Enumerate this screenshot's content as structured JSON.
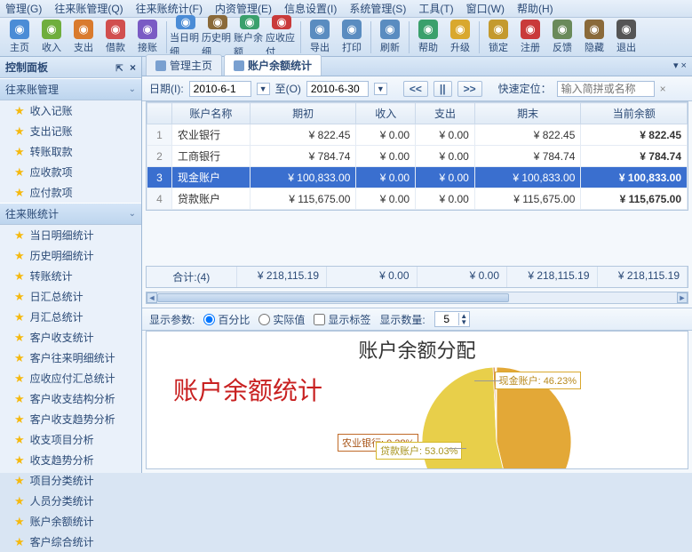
{
  "menu": [
    "管理(G)",
    "往来账管理(Q)",
    "往来账统计(F)",
    "内资管理(E)",
    "信息设置(I)",
    "系统管理(S)",
    "工具(T)",
    "窗口(W)",
    "帮助(H)"
  ],
  "toolbar": [
    {
      "label": "主页",
      "color": "#4b8cd6"
    },
    {
      "label": "收入",
      "color": "#6fae3d"
    },
    {
      "label": "支出",
      "color": "#d97b2e"
    },
    {
      "label": "借款",
      "color": "#d14f4f"
    },
    {
      "label": "接账",
      "color": "#7a5bc4"
    },
    {
      "sep": true
    },
    {
      "label": "当日明细",
      "color": "#4b8cd6"
    },
    {
      "label": "历史明细",
      "color": "#8a6a3a"
    },
    {
      "label": "账户余额",
      "color": "#3aa06c"
    },
    {
      "label": "应收应付",
      "color": "#c93a3a"
    },
    {
      "sep": true
    },
    {
      "label": "导出",
      "color": "#5a8cc0"
    },
    {
      "label": "打印",
      "color": "#5a8cc0"
    },
    {
      "sep": true
    },
    {
      "label": "刷新",
      "color": "#5a8cc0"
    },
    {
      "sep": true
    },
    {
      "label": "帮助",
      "color": "#3aa06c"
    },
    {
      "label": "升级",
      "color": "#d9a82e"
    },
    {
      "sep": true
    },
    {
      "label": "锁定",
      "color": "#c49a2e"
    },
    {
      "label": "注册",
      "color": "#c93a3a"
    },
    {
      "label": "反馈",
      "color": "#6a8a5a"
    },
    {
      "label": "隐藏",
      "color": "#8a6a3a"
    },
    {
      "label": "退出",
      "color": "#555"
    }
  ],
  "panel_title": "控制面板",
  "pin_symbol": "⇱",
  "close_symbol": "×",
  "sidebar": [
    {
      "header": "往来账管理",
      "items": [
        "收入记账",
        "支出记账",
        "转账取款",
        "应收款项",
        "应付款项"
      ]
    },
    {
      "header": "往来账统计",
      "items": [
        "当日明细统计",
        "历史明细统计",
        "转账统计",
        "日汇总统计",
        "月汇总统计",
        "客户收支统计",
        "客户往来明细统计",
        "应收应付汇总统计",
        "客户收支结构分析",
        "客户收支趋势分析",
        "收支项目分析",
        "收支趋势分析",
        "项目分类统计",
        "人员分类统计",
        "账户余额统计",
        "客户综合统计"
      ]
    }
  ],
  "tabs": [
    {
      "label": "管理主页"
    },
    {
      "label": "账户余额统计",
      "active": true
    }
  ],
  "filter": {
    "date_label": "日期(I):",
    "from": "2010-6-1",
    "to_label": "至(O)",
    "to": "2010-6-30",
    "quick_label": "快速定位：",
    "quick_ph": "输入简拼或名称"
  },
  "nav": {
    "first": "<<",
    "pause": "||",
    "last": ">>"
  },
  "grid": {
    "cols": [
      "",
      "账户名称",
      "期初",
      "收入",
      "支出",
      "期末",
      "当前余额"
    ],
    "rows": [
      {
        "idx": "1",
        "name": "农业银行",
        "a": "¥ 822.45",
        "b": "¥ 0.00",
        "c": "¥ 0.00",
        "d": "¥ 822.45",
        "e": "¥ 822.45"
      },
      {
        "idx": "2",
        "name": "工商银行",
        "a": "¥ 784.74",
        "b": "¥ 0.00",
        "c": "¥ 0.00",
        "d": "¥ 784.74",
        "e": "¥ 784.74"
      },
      {
        "idx": "3",
        "name": "现金账户",
        "a": "¥ 100,833.00",
        "b": "¥ 0.00",
        "c": "¥ 0.00",
        "d": "¥ 100,833.00",
        "e": "¥ 100,833.00",
        "sel": true
      },
      {
        "idx": "4",
        "name": "贷款账户",
        "a": "¥ 115,675.00",
        "b": "¥ 0.00",
        "c": "¥ 0.00",
        "d": "¥ 115,675.00",
        "e": "¥ 115,675.00"
      }
    ],
    "sum": {
      "label": "合计:(4)",
      "a": "¥ 218,115.19",
      "b": "¥ 0.00",
      "c": "¥ 0.00",
      "d": "¥ 218,115.19",
      "e": "¥ 218,115.19"
    }
  },
  "chartctrl": {
    "param_label": "显示参数:",
    "opt1": "百分比",
    "opt2": "实际值",
    "chk": "显示标签",
    "count_label": "显示数量:",
    "count": "5"
  },
  "chart_data": {
    "type": "pie",
    "title": "账户余额分配",
    "watermark": "账户余额统计",
    "series": [
      {
        "name": "现金账户",
        "pct": 46.23,
        "color": "#e3a837"
      },
      {
        "name": "贷款账户",
        "pct": 53.03,
        "color": "#e8cf4a"
      },
      {
        "name": "农业银行",
        "pct": 0.38,
        "color": "#d07a30"
      }
    ],
    "callouts": [
      {
        "text": "现金账户: 46.23%"
      },
      {
        "text": "农业银行: 0.38%"
      },
      {
        "text": "贷款账户: 53.03%"
      }
    ]
  }
}
